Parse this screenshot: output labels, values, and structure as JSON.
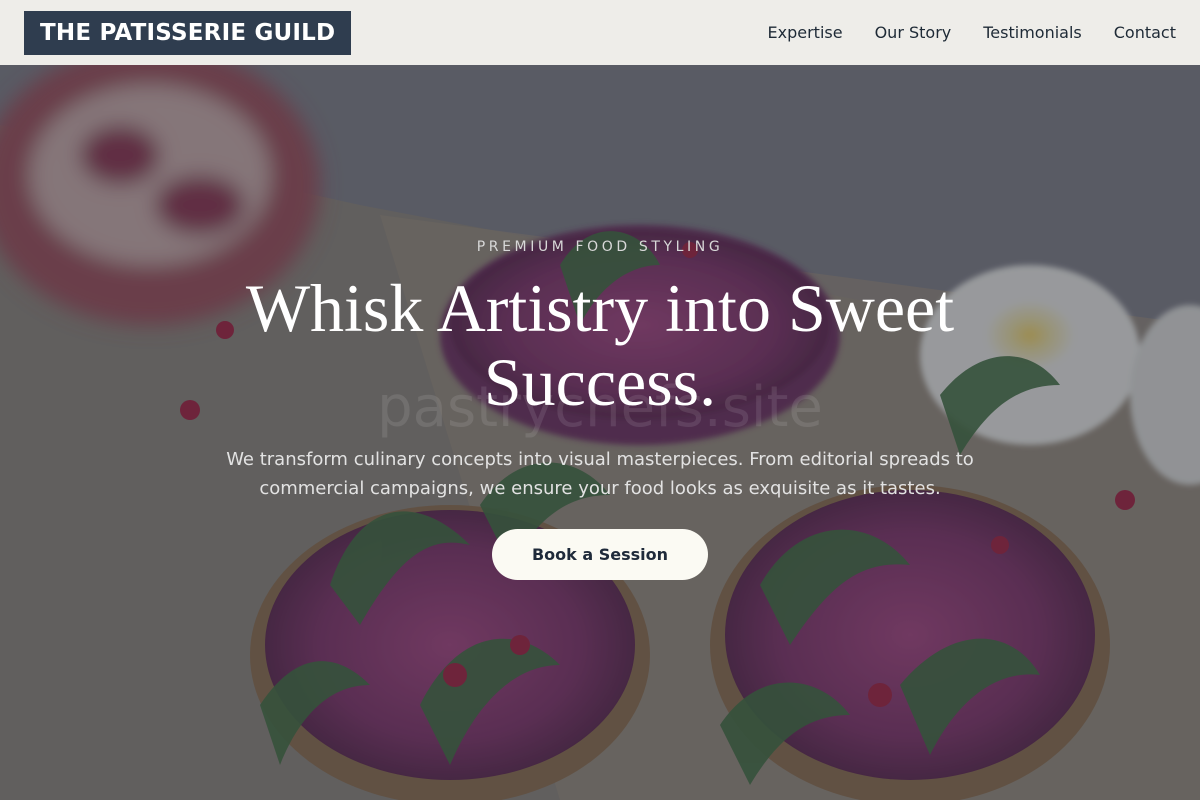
{
  "header": {
    "logo": "THE PATISSERIE GUILD",
    "nav": [
      {
        "label": "Expertise"
      },
      {
        "label": "Our Story"
      },
      {
        "label": "Testimonials"
      },
      {
        "label": "Contact"
      }
    ]
  },
  "hero": {
    "eyebrow": "PREMIUM FOOD STYLING",
    "title": "Whisk Artistry into Sweet Success.",
    "watermark": "pastrychefs.site",
    "subtitle": "We transform culinary concepts into visual masterpieces. From editorial spreads to commercial campaigns, we ensure your food looks as exquisite as it tastes.",
    "cta_label": "Book a Session"
  },
  "colors": {
    "header_bg": "#eeede9",
    "logo_bg": "#2f3d4f",
    "cta_bg": "#fbfaf3",
    "overlay": "#28303e"
  }
}
